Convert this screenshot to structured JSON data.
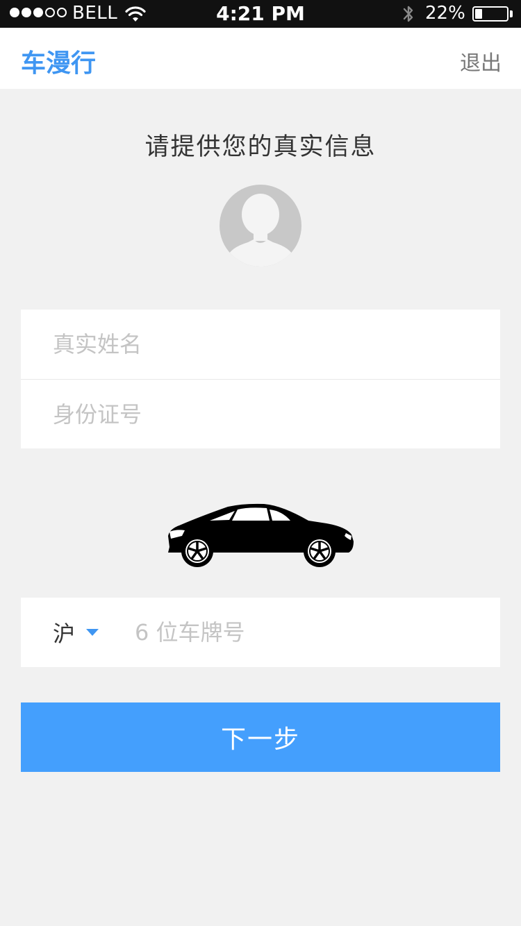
{
  "status_bar": {
    "carrier": "BELL",
    "time": "4:21 PM",
    "battery_percent_text": "22%",
    "battery_level": 0.22,
    "signal_bars_filled": 3,
    "signal_bars_total": 5
  },
  "nav": {
    "title": "车漫行",
    "logout_label": "退出"
  },
  "form": {
    "prompt": "请提供您的真实信息",
    "name_placeholder": "真实姓名",
    "id_placeholder": "身份证号",
    "province_value": "沪",
    "plate_placeholder": "6 位车牌号"
  },
  "actions": {
    "next_label": "下一步"
  },
  "colors": {
    "accent": "#3f96f2",
    "button": "#449ffd",
    "background": "#f1f1f1",
    "status_bar": "#111111"
  },
  "icons": {
    "avatar": "person-silhouette-icon",
    "car": "car-icon",
    "wifi": "wifi-icon",
    "bluetooth": "bluetooth-icon",
    "caret": "caret-down-icon"
  }
}
